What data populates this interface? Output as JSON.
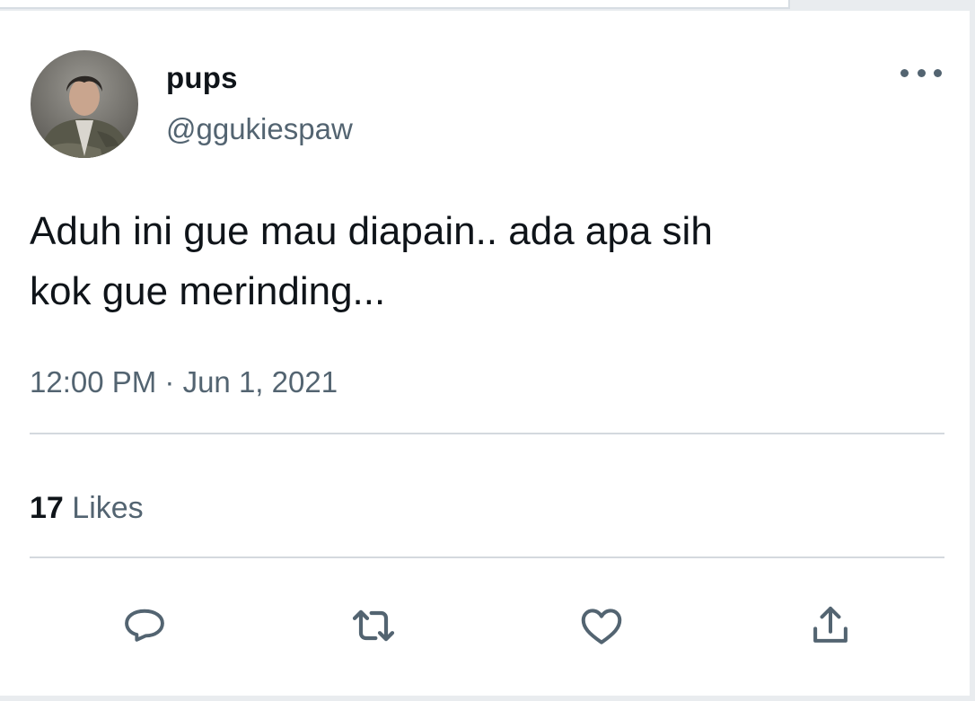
{
  "tweet": {
    "display_name": "pups",
    "handle": "@ggukiespaw",
    "text_line1": "Aduh ini gue mau diapain.. ada apa sih",
    "text_line2": "kok gue merinding...",
    "timestamp": "12:00 PM · Jun 1, 2021",
    "likes_count": "17",
    "likes_label": "Likes"
  },
  "icons": {
    "more": "more-horizontal-icon",
    "reply": "reply-icon",
    "retweet": "retweet-icon",
    "like": "heart-icon",
    "share": "share-icon"
  },
  "colors": {
    "primary_text": "#0f1419",
    "secondary_text": "#536471",
    "divider": "#d4d9de",
    "background": "#ffffff"
  }
}
